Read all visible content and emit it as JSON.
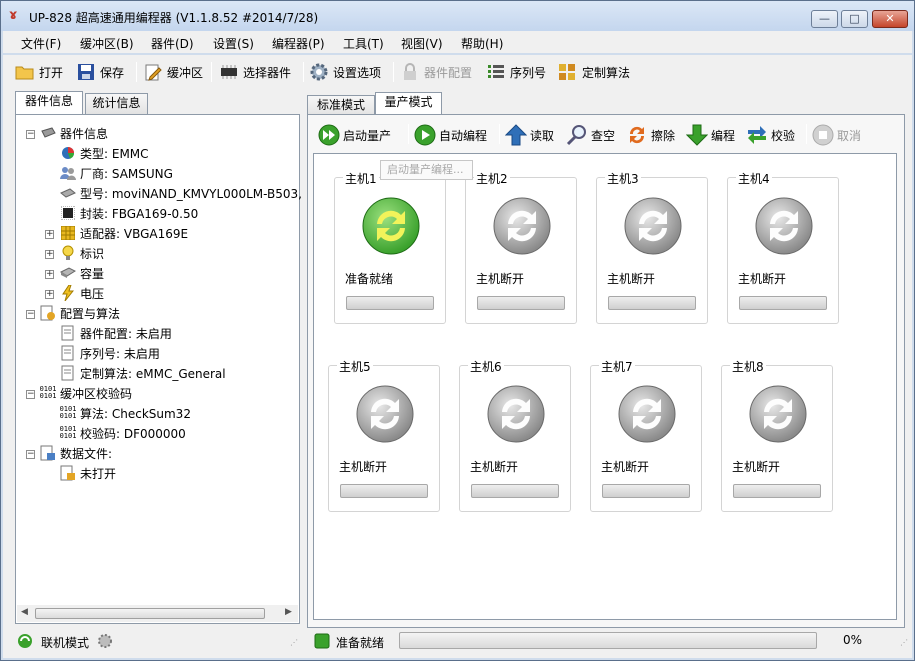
{
  "window": {
    "title": "UP-828 超高速通用编程器   (V1.1.8.52 #2014/7/28)",
    "controls": {
      "min": "—",
      "max": "□",
      "close": "✕"
    }
  },
  "menu": [
    "文件(F)",
    "缓冲区(B)",
    "器件(D)",
    "设置(S)",
    "编程器(P)",
    "工具(T)",
    "视图(V)",
    "帮助(H)"
  ],
  "toolbar": {
    "open": "打开",
    "save": "保存",
    "buffer": "缓冲区",
    "select_device": "选择器件",
    "settings": "设置选项",
    "device_config": "器件配置",
    "serial": "序列号",
    "custom_algo": "定制算法"
  },
  "left_tabs": [
    "器件信息",
    "统计信息"
  ],
  "tree": {
    "device_info": "器件信息",
    "type": "类型: EMMC",
    "vendor": "厂商: SAMSUNG",
    "model": "型号: moviNAND_KMVYL000LM-B503,",
    "package": "封装: FBGA169-0.50",
    "adapter": "适配器: VBGA169E",
    "mark": "标识",
    "capacity": "容量",
    "voltage": "电压",
    "config_algo": "配置与算法",
    "dev_config": "器件配置: 未启用",
    "serial": "序列号: 未启用",
    "custom_algo": "定制算法: eMMC_General",
    "buffer_check": "缓冲区校验码",
    "algo": "算法: CheckSum32",
    "checksum": "校验码: DF000000",
    "data_file": "数据文件:",
    "not_open": "未打开"
  },
  "right_tabs": [
    "标准模式",
    "量产模式"
  ],
  "actions": {
    "start_mass": "启动量产",
    "auto_program": "自动编程",
    "read": "读取",
    "blank_check": "查空",
    "erase": "擦除",
    "program": "编程",
    "verify": "校验",
    "cancel": "取消"
  },
  "tooltip": "启动量产编程...",
  "hosts": [
    {
      "name": "主机1",
      "status": "准备就绪",
      "ready": true
    },
    {
      "name": "主机2",
      "status": "主机断开",
      "ready": false
    },
    {
      "name": "主机3",
      "status": "主机断开",
      "ready": false
    },
    {
      "name": "主机4",
      "status": "主机断开",
      "ready": false
    },
    {
      "name": "主机5",
      "status": "主机断开",
      "ready": false
    },
    {
      "name": "主机6",
      "status": "主机断开",
      "ready": false
    },
    {
      "name": "主机7",
      "status": "主机断开",
      "ready": false
    },
    {
      "name": "主机8",
      "status": "主机断开",
      "ready": false
    }
  ],
  "status": {
    "mode": "联机模式",
    "state": "准备就绪",
    "progress_text": "0%",
    "progress": 0
  },
  "colors": {
    "ready": "#3aa12c",
    "disconnected": "#8a8a8a",
    "accent": "#2f6fb8"
  }
}
